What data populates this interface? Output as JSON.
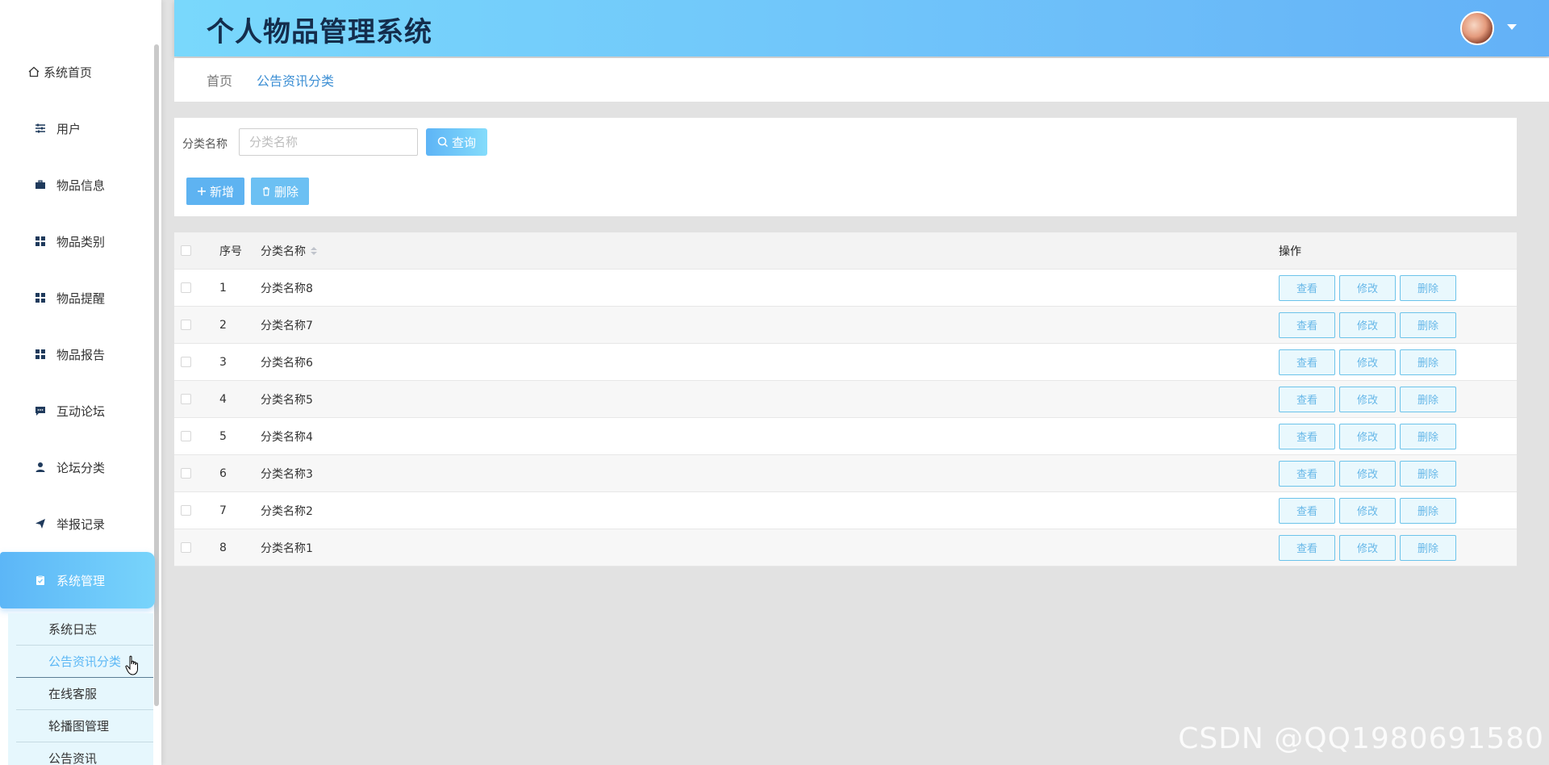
{
  "app": {
    "title": "个人物品管理系统"
  },
  "sidebar": {
    "items": [
      {
        "label": "系统首页",
        "icon": "home-icon"
      },
      {
        "label": "用户",
        "icon": "sliders-icon"
      },
      {
        "label": "物品信息",
        "icon": "briefcase-icon"
      },
      {
        "label": "物品类别",
        "icon": "grid-icon"
      },
      {
        "label": "物品提醒",
        "icon": "grid-icon"
      },
      {
        "label": "物品报告",
        "icon": "grid-icon"
      },
      {
        "label": "互动论坛",
        "icon": "chat-icon"
      },
      {
        "label": "论坛分类",
        "icon": "user-icon"
      },
      {
        "label": "举报记录",
        "icon": "send-icon"
      },
      {
        "label": "系统管理",
        "icon": "clipboard-icon"
      }
    ],
    "submenu": [
      {
        "label": "系统日志"
      },
      {
        "label": "公告资讯分类"
      },
      {
        "label": "在线客服"
      },
      {
        "label": "轮播图管理"
      },
      {
        "label": "公告资讯"
      }
    ]
  },
  "breadcrumb": {
    "home": "首页",
    "current": "公告资讯分类"
  },
  "search": {
    "label": "分类名称",
    "placeholder": "分类名称",
    "query_label": "查询",
    "add_label": "新增",
    "delete_label": "删除"
  },
  "table": {
    "headers": {
      "index": "序号",
      "name": "分类名称",
      "actions": "操作"
    },
    "rows": [
      {
        "index": "1",
        "name": "分类名称8"
      },
      {
        "index": "2",
        "name": "分类名称7"
      },
      {
        "index": "3",
        "name": "分类名称6"
      },
      {
        "index": "4",
        "name": "分类名称5"
      },
      {
        "index": "5",
        "name": "分类名称4"
      },
      {
        "index": "6",
        "name": "分类名称3"
      },
      {
        "index": "7",
        "name": "分类名称2"
      },
      {
        "index": "8",
        "name": "分类名称1"
      }
    ],
    "actions": {
      "view": "查看",
      "edit": "修改",
      "delete": "删除"
    }
  },
  "watermark": "CSDN @QQ1980691580",
  "colors": {
    "accent": "#5cb6f7",
    "header_start": "#79d8fc",
    "header_end": "#63b1f7"
  }
}
